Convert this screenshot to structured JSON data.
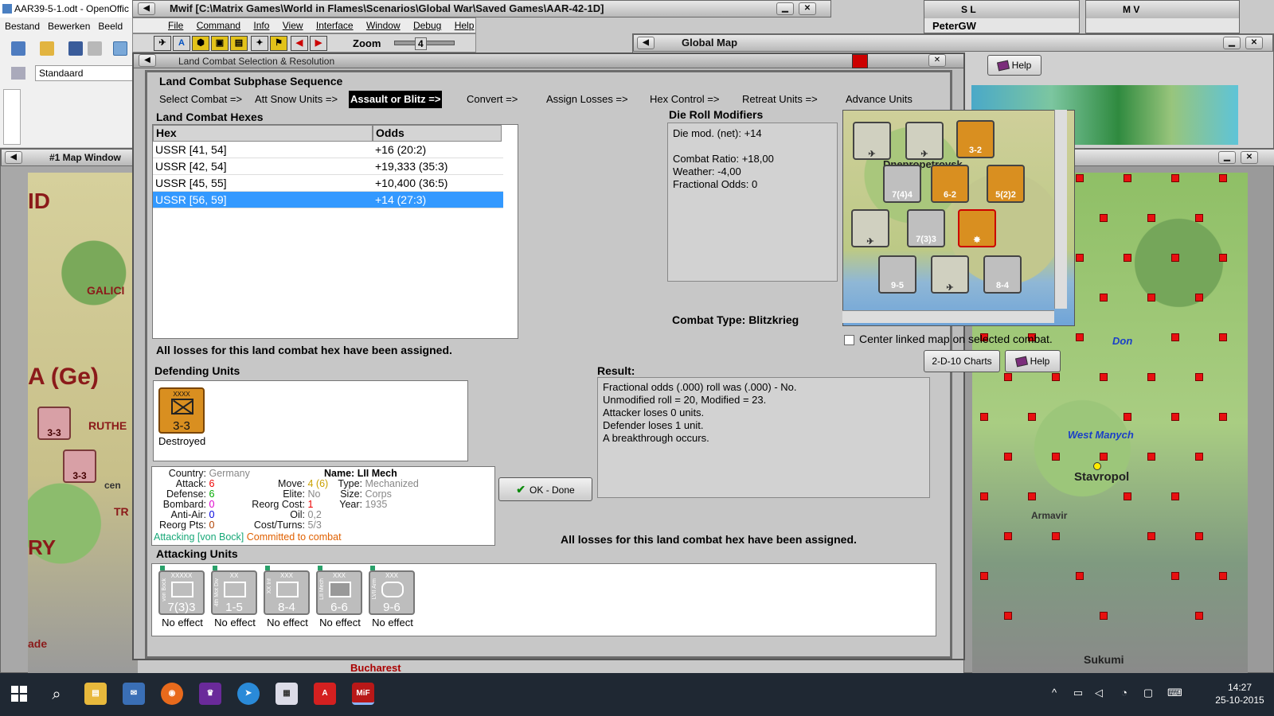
{
  "openoffice": {
    "title": "AAR39-5-1.odt - OpenOffic",
    "menu": [
      "Bestand",
      "Bewerken",
      "Beeld"
    ],
    "style_value": "Standaard"
  },
  "mwif": {
    "title": "Mwif [C:\\Matrix Games\\World in Flames\\Scenarios\\Global War\\Saved Games\\AAR-42-1D]",
    "menu": [
      "File",
      "Command",
      "Info",
      "View",
      "Interface",
      "Window",
      "Debug",
      "Help"
    ],
    "zoom_label": "Zoom",
    "zoom_value": "4"
  },
  "side_windows": {
    "sl_title": "S L",
    "sl_user": "PeterGW",
    "mv_title": "M V",
    "global_title": "Global Map",
    "global_help": "Help"
  },
  "map1": {
    "title": "#1 Map Window",
    "labels": [
      "ID",
      "GALICI",
      "A (Ge)",
      "RUTHE",
      "cen",
      "TR",
      "RY",
      "ade"
    ],
    "counters": [
      "3-3",
      "3-3"
    ]
  },
  "map2": {
    "labels": [
      "Don",
      "West Manych",
      "Stavropol",
      "Armavir",
      "Sukumi"
    ]
  },
  "dialog": {
    "title": "Land Combat Selection & Resolution",
    "sequence_label": "Land Combat Subphase Sequence",
    "sequence": [
      {
        "label": "Select Combat =>",
        "active": false
      },
      {
        "label": "Att Snow Units =>",
        "active": false
      },
      {
        "label": "Assault or Blitz =>",
        "active": true
      },
      {
        "label": "Convert =>",
        "active": false
      },
      {
        "label": "Assign Losses =>",
        "active": false
      },
      {
        "label": "Hex Control =>",
        "active": false
      },
      {
        "label": "Retreat Units =>",
        "active": false
      },
      {
        "label": "Advance Units",
        "active": false
      }
    ],
    "hexes_label": "Land Combat Hexes",
    "hex_columns": [
      "Hex",
      "Odds"
    ],
    "hex_rows": [
      {
        "hex": "USSR [41, 54]",
        "odds": "+16 (20:2)",
        "selected": false
      },
      {
        "hex": "USSR [42, 54]",
        "odds": "+19,333 (35:3)",
        "selected": false
      },
      {
        "hex": "USSR [45, 55]",
        "odds": "+10,400 (36:5)",
        "selected": false
      },
      {
        "hex": "USSR [56, 59]",
        "odds": "+14 (27:3)",
        "selected": true
      }
    ],
    "drm_label": "Die Roll Modifiers",
    "drm_lines": [
      "Die mod. (net): +14",
      "",
      "Combat Ratio: +18,00",
      "Weather: -4,00",
      "Fractional Odds: 0"
    ],
    "combat_type": "Combat Type:  Blitzkrieg",
    "center_check_label": "Center linked map on selected combat.",
    "charts_button": "2-D-10 Charts",
    "help_button": "Help",
    "losses_msg": "All losses for this land combat hex have been assigned.",
    "defending_label": "Defending Units",
    "defender": {
      "strength": "3-3",
      "status": "Destroyed",
      "level": "XXXX"
    },
    "result_label": "Result:",
    "result_lines": [
      "Fractional odds (.000) roll was (.000)  - No.",
      "Unmodified roll = 20, Modified = 23.",
      "Attacker loses 0 units.",
      "Defender loses 1 unit.",
      "A breakthrough occurs."
    ],
    "unit_info": {
      "country_label": "Country:",
      "country": "Germany",
      "attack_label": "Attack:",
      "attack": "6",
      "defense_label": "Defense:",
      "defense": "6",
      "bombard_label": "Bombard:",
      "bombard": "0",
      "antiair_label": "Anti-Air:",
      "antiair": "0",
      "reorgpts_label": "Reorg Pts:",
      "reorgpts": "0",
      "name_label": "Name:",
      "name": "LII Mech",
      "move_label": "Move:",
      "move": "4 (6)",
      "type_label": "Type:",
      "type": "Mechanized",
      "elite_label": "Elite:",
      "elite": "No",
      "size_label": "Size:",
      "size": "Corps",
      "reorg_label": "Reorg Cost:",
      "reorg": "1",
      "year_label": "Year:",
      "year": "1935",
      "oil_label": "Oil:",
      "oil": "0,2",
      "cost_label": "Cost/Turns:",
      "cost": "5/3",
      "attacking": "Attacking [von Bock]",
      "committed": "Committed to combat"
    },
    "ok_button": "OK - Done",
    "attacking_label": "Attacking Units",
    "attackers": [
      {
        "strength": "7(3)3",
        "level": "XXXXX",
        "name": "von Bock",
        "status": "No effect"
      },
      {
        "strength": "1-5",
        "level": "XX",
        "name": "4th Mot Div",
        "status": "No effect"
      },
      {
        "strength": "8-4",
        "level": "XXX",
        "name": "XX Inf",
        "status": "No effect"
      },
      {
        "strength": "6-6",
        "level": "XXX",
        "name": "LII Mech",
        "status": "No effect"
      },
      {
        "strength": "9-6",
        "level": "XXX",
        "name": "LVII Arm",
        "status": "No effect"
      }
    ],
    "mini_map_counters": [
      "3-2",
      "7(4)4",
      "6-2",
      "5(2)2",
      "7(3)3",
      "9-5",
      "8-4"
    ],
    "mini_map_place": "Dnepropetrovsk"
  },
  "map_status": "Bucharest",
  "taskbar": {
    "time": "14:27",
    "date": "25-10-2015"
  },
  "colors": {
    "selection": "#3399ff",
    "german_counter": "#d98f20",
    "ok_check": "#0a8a0a"
  }
}
